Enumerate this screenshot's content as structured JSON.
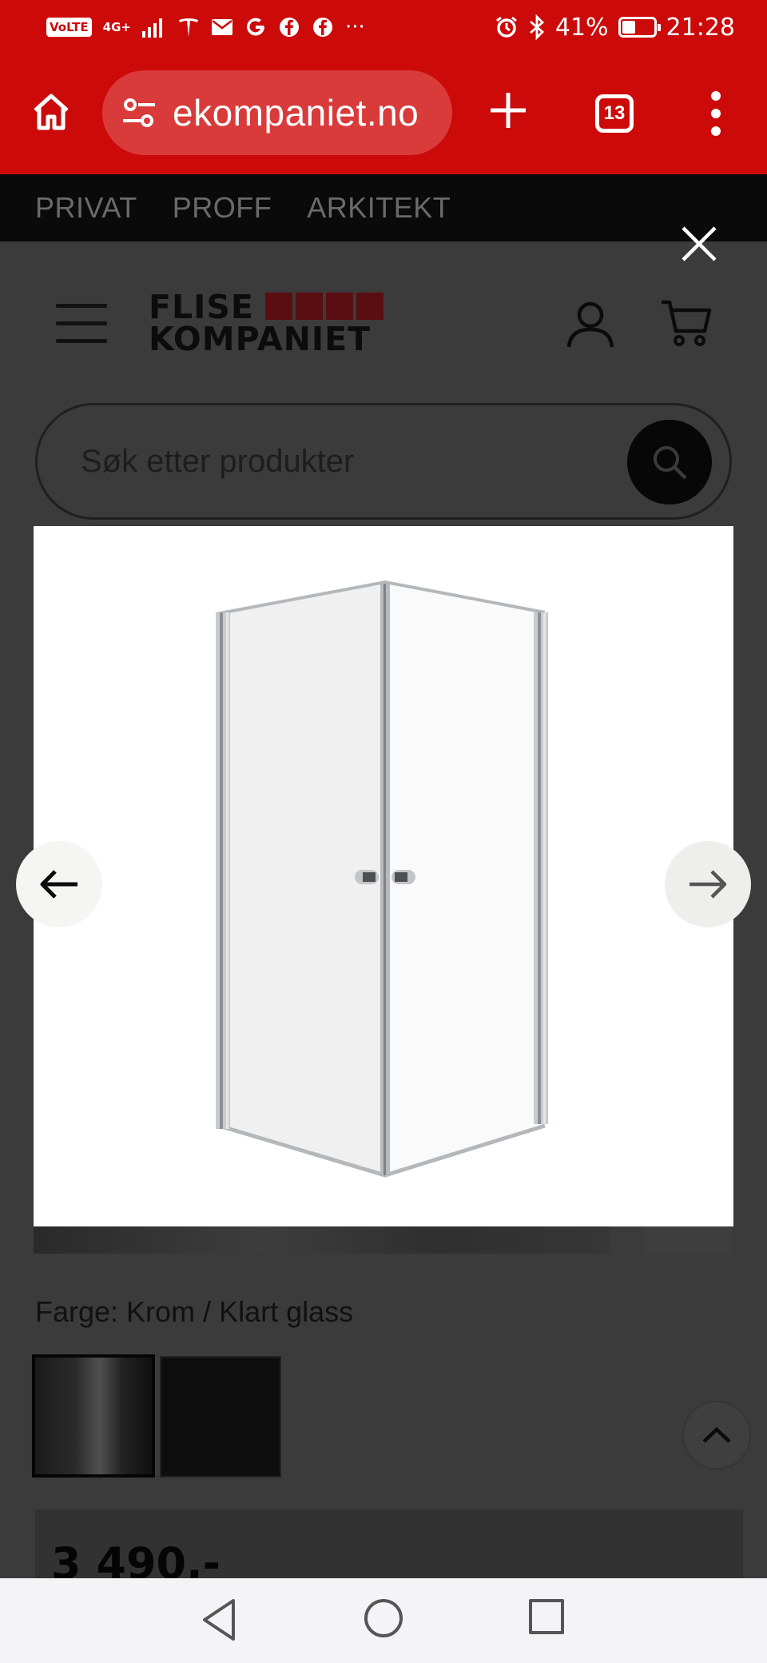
{
  "status_bar": {
    "volte": "VoLTE",
    "network": "4G+",
    "notif_icons": [
      "tesla-icon",
      "mail-icon",
      "google-icon",
      "facebook-icon",
      "facebook-icon"
    ],
    "more": "···",
    "battery_percent": "41%",
    "battery_level": 0.41,
    "time": "21:28"
  },
  "browser": {
    "url": "ekompaniet.no",
    "tab_count": "13"
  },
  "site_nav": {
    "items": [
      "PRIVAT",
      "PROFF",
      "ARKITEKT"
    ]
  },
  "header": {
    "logo_line1": "FLISE",
    "logo_line2": "KOMPANIET",
    "logo_reg": "®"
  },
  "search": {
    "placeholder": "Søk etter produkter"
  },
  "product": {
    "color_label": "Farge: Krom / Klart glass",
    "price": "3 490,-",
    "swatches": [
      "krom-swatch",
      "svart-swatch"
    ]
  },
  "colors": {
    "brand_red": "#cc0a0a",
    "overlay_dim": "#3b3b3b",
    "logo_red": "#5a0e12"
  }
}
